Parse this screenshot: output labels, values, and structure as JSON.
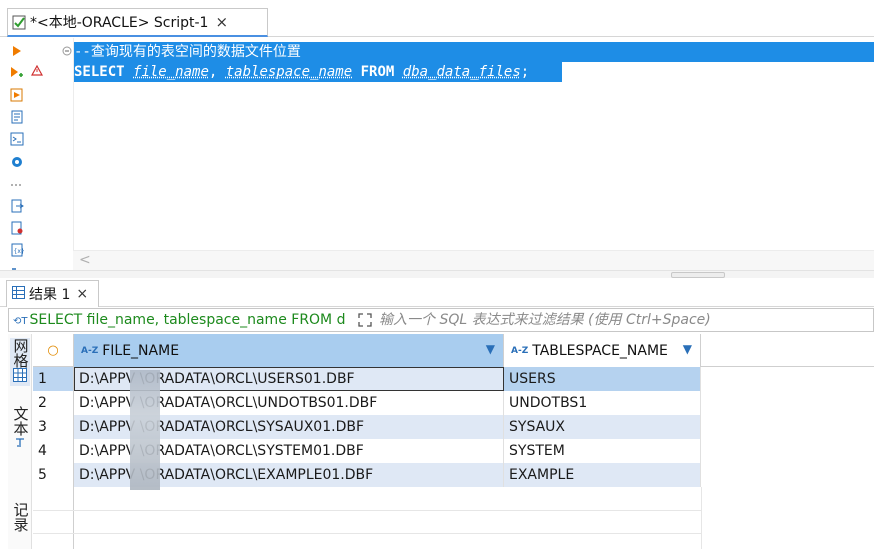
{
  "editor": {
    "tab_title": "*<本地-ORACLE> Script-1",
    "close_glyph": "×",
    "code": {
      "line1_comment": "--查询现有的表空间的数据文件位置",
      "line2": {
        "select": "SELECT",
        "col1": "file_name",
        "sep": ", ",
        "col2": "tablespace_name",
        "from": "FROM",
        "table": "dba_data_files",
        "end": ";"
      }
    },
    "scroll_left_glyph": "<"
  },
  "results": {
    "tab_label": "结果 1",
    "close_glyph": "×",
    "filter_sql": "SELECT file_name, tablespace_name FROM d",
    "filter_placeholder": "输入一个 SQL 表达式来过滤结果 (使用 Ctrl+Space)",
    "view_switcher": {
      "grid_label": "网格",
      "text_label": "文本",
      "record_label": "记录"
    },
    "columns": [
      "FILE_NAME",
      "TABLESPACE_NAME"
    ],
    "column_type_badge": "A-Z",
    "rows": [
      {
        "num": "1",
        "file_name": "D:\\APPV      \\ORADATA\\ORCL\\USERS01.DBF",
        "tablespace_name": "USERS"
      },
      {
        "num": "2",
        "file_name": "D:\\APPV      \\ORADATA\\ORCL\\UNDOTBS01.DBF",
        "tablespace_name": "UNDOTBS1"
      },
      {
        "num": "3",
        "file_name": "D:\\APPV      \\ORADATA\\ORCL\\SYSAUX01.DBF",
        "tablespace_name": "SYSAUX"
      },
      {
        "num": "4",
        "file_name": "D:\\APPV      \\ORADATA\\ORCL\\SYSTEM01.DBF",
        "tablespace_name": "SYSTEM"
      },
      {
        "num": "5",
        "file_name": "D:\\APPV      \\ORADATA\\ORCL\\EXAMPLE01.DBF",
        "tablespace_name": "EXAMPLE"
      }
    ]
  },
  "colors": {
    "selection": "#1e8de6",
    "header_selected": "#a9cdef",
    "row_alt": "#dfe8f5",
    "filter_sql": "#1d8a1d"
  }
}
